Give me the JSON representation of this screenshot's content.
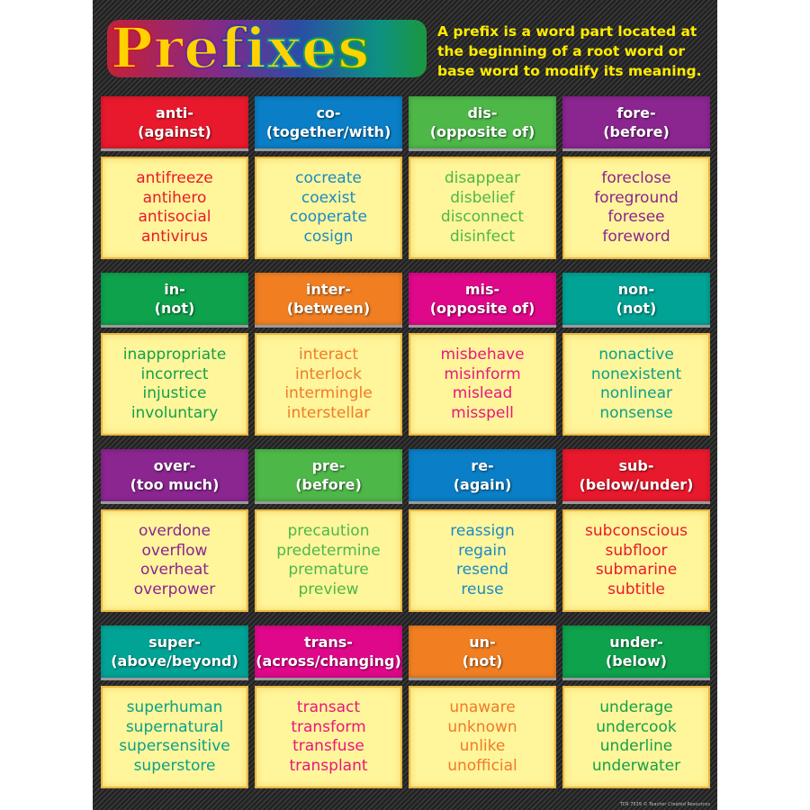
{
  "title": "Prefixes",
  "definition": "A prefix is a word part located at the beginning of a root word or base word to modify its meaning.",
  "footer": "TCR 7539 © Teacher Created Resources",
  "prefixes": [
    {
      "prefix": "anti-",
      "meaning": "(against)",
      "header_color": "#e8192c",
      "word_color": "#e8192c",
      "words": [
        "antifreeze",
        "antihero",
        "antisocial",
        "antivirus"
      ]
    },
    {
      "prefix": "co-",
      "meaning": "(together/with)",
      "header_color": "#0a7ec6",
      "word_color": "#1a8ac6",
      "words": [
        "cocreate",
        "coexist",
        "cooperate",
        "cosign"
      ]
    },
    {
      "prefix": "dis-",
      "meaning": "(opposite of)",
      "header_color": "#4db848",
      "word_color": "#4db848",
      "words": [
        "disappear",
        "disbelief",
        "disconnect",
        "disinfect"
      ]
    },
    {
      "prefix": "fore-",
      "meaning": "(before)",
      "header_color": "#8b2590",
      "word_color": "#8b2590",
      "words": [
        "foreclose",
        "foreground",
        "foresee",
        "foreword"
      ]
    },
    {
      "prefix": "in-",
      "meaning": "(not)",
      "header_color": "#0ea24c",
      "word_color": "#14a04a",
      "words": [
        "inappropriate",
        "incorrect",
        "injustice",
        "involuntary"
      ]
    },
    {
      "prefix": "inter-",
      "meaning": "(between)",
      "header_color": "#f17f22",
      "word_color": "#f07a2a",
      "words": [
        "interact",
        "interlock",
        "intermingle",
        "interstellar"
      ]
    },
    {
      "prefix": "mis-",
      "meaning": "(opposite of)",
      "header_color": "#e0088a",
      "word_color": "#e8157f",
      "words": [
        "misbehave",
        "misinform",
        "mislead",
        "misspell"
      ]
    },
    {
      "prefix": "non-",
      "meaning": "(not)",
      "header_color": "#00a395",
      "word_color": "#0aa08a",
      "words": [
        "nonactive",
        "nonexistent",
        "nonlinear",
        "nonsense"
      ]
    },
    {
      "prefix": "over-",
      "meaning": "(too much)",
      "header_color": "#8b2590",
      "word_color": "#8b2590",
      "words": [
        "overdone",
        "overflow",
        "overheat",
        "overpower"
      ]
    },
    {
      "prefix": "pre-",
      "meaning": "(before)",
      "header_color": "#4db848",
      "word_color": "#4db848",
      "words": [
        "precaution",
        "predetermine",
        "premature",
        "preview"
      ]
    },
    {
      "prefix": "re-",
      "meaning": "(again)",
      "header_color": "#0a7ec6",
      "word_color": "#1a8ac6",
      "words": [
        "reassign",
        "regain",
        "resend",
        "reuse"
      ]
    },
    {
      "prefix": "sub-",
      "meaning": "(below/under)",
      "header_color": "#e8192c",
      "word_color": "#e8192c",
      "words": [
        "subconscious",
        "subfloor",
        "submarine",
        "subtitle"
      ]
    },
    {
      "prefix": "super-",
      "meaning": "(above/beyond)",
      "header_color": "#00a395",
      "word_color": "#0aa08a",
      "words": [
        "superhuman",
        "supernatural",
        "supersensitive",
        "superstore"
      ]
    },
    {
      "prefix": "trans-",
      "meaning": "(across/changing)",
      "header_color": "#e0088a",
      "word_color": "#e8157f",
      "words": [
        "transact",
        "transform",
        "transfuse",
        "transplant"
      ]
    },
    {
      "prefix": "un-",
      "meaning": "(not)",
      "header_color": "#f17f22",
      "word_color": "#f07a2a",
      "words": [
        "unaware",
        "unknown",
        "unlike",
        "unofficial"
      ]
    },
    {
      "prefix": "under-",
      "meaning": "(below)",
      "header_color": "#0ea24c",
      "word_color": "#14a04a",
      "words": [
        "underage",
        "undercook",
        "underline",
        "underwater"
      ]
    }
  ]
}
